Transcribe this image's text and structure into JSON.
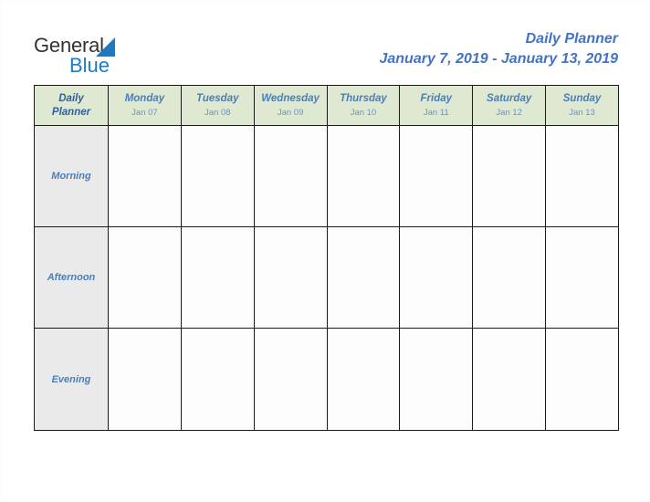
{
  "brand": {
    "name_part1": "General",
    "name_part2": "Blue",
    "triangle_icon": "triangle-icon",
    "accent_color": "#1f7ac4",
    "text_color": "#333333"
  },
  "header": {
    "title": "Daily Planner",
    "date_range": "January 7, 2019 - January 13, 2019",
    "title_color": "#4472c4"
  },
  "table": {
    "corner": {
      "line1": "Daily",
      "line2": "Planner"
    },
    "header_bg_color": "#dfe8d0",
    "row_label_bg_color": "#eaeaea",
    "grid_color": "#1a1a1a",
    "columns": [
      {
        "day": "Monday",
        "date": "Jan 07"
      },
      {
        "day": "Tuesday",
        "date": "Jan 08"
      },
      {
        "day": "Wednesday",
        "date": "Jan 09"
      },
      {
        "day": "Thursday",
        "date": "Jan 10"
      },
      {
        "day": "Friday",
        "date": "Jan 11"
      },
      {
        "day": "Saturday",
        "date": "Jan 12"
      },
      {
        "day": "Sunday",
        "date": "Jan 13"
      }
    ],
    "rows": [
      {
        "label": "Morning",
        "cells": [
          "",
          "",
          "",
          "",
          "",
          "",
          ""
        ]
      },
      {
        "label": "Afternoon",
        "cells": [
          "",
          "",
          "",
          "",
          "",
          "",
          ""
        ]
      },
      {
        "label": "Evening",
        "cells": [
          "",
          "",
          "",
          "",
          "",
          "",
          ""
        ]
      }
    ]
  }
}
